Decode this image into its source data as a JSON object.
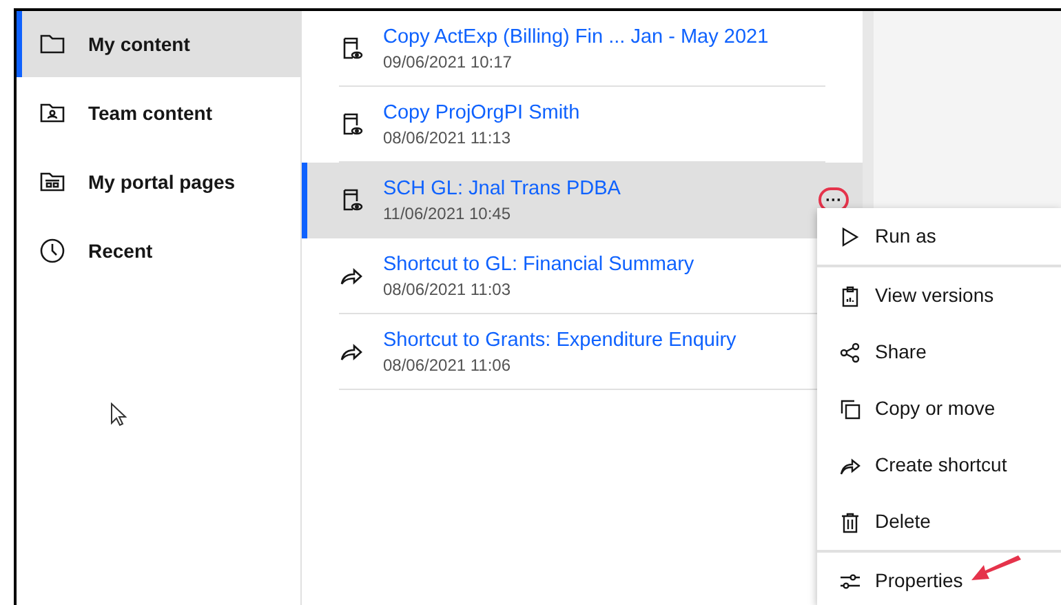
{
  "sidebar": {
    "items": [
      {
        "label": "My content",
        "selected": true
      },
      {
        "label": "Team content",
        "selected": false
      },
      {
        "label": "My portal pages",
        "selected": false
      },
      {
        "label": "Recent",
        "selected": false
      }
    ]
  },
  "content": {
    "rows": [
      {
        "kind": "report",
        "title": "Copy ActExp (Billing) Fin ... Jan - May 2021",
        "date": "09/06/2021 10:17",
        "selected": false
      },
      {
        "kind": "report",
        "title": "Copy ProjOrgPI Smith",
        "date": "08/06/2021 11:13",
        "selected": false
      },
      {
        "kind": "report",
        "title": "SCH GL: Jnal Trans PDBA",
        "date": "11/06/2021 10:45",
        "selected": true
      },
      {
        "kind": "shortcut",
        "title": "Shortcut to GL: Financial Summary",
        "date": "08/06/2021 11:03",
        "selected": false
      },
      {
        "kind": "shortcut",
        "title": "Shortcut to Grants: Expenditure Enquiry",
        "date": "08/06/2021 11:06",
        "selected": false
      }
    ]
  },
  "more_button": {
    "label": "···"
  },
  "context_menu": {
    "groups": [
      [
        "Run as"
      ],
      [
        "View versions",
        "Share",
        "Copy or move",
        "Create shortcut",
        "Delete"
      ],
      [
        "Properties"
      ]
    ]
  }
}
